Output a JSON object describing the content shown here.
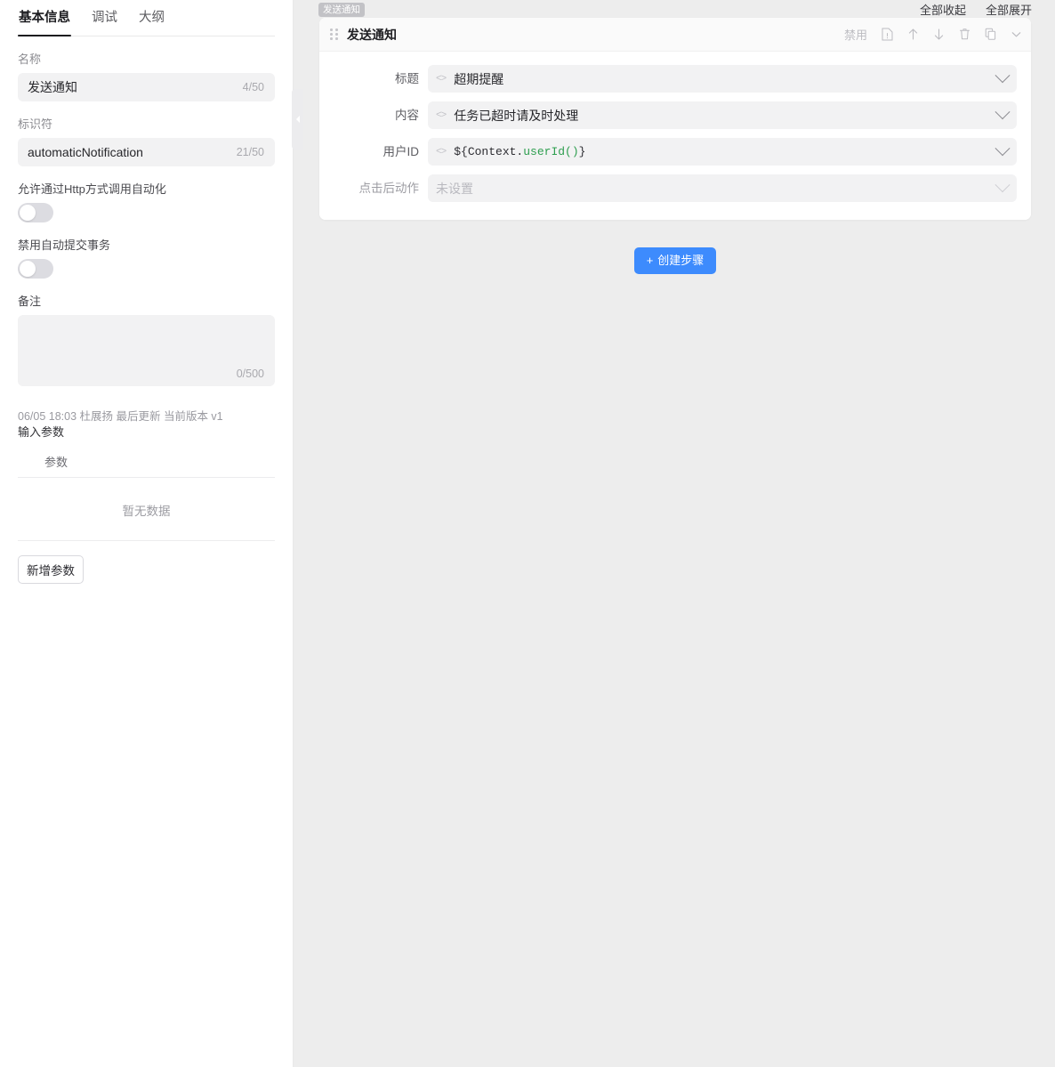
{
  "sidebar": {
    "tabs": [
      {
        "label": "基本信息",
        "active": true
      },
      {
        "label": "调试",
        "active": false
      },
      {
        "label": "大纲",
        "active": false
      }
    ],
    "name_field": {
      "label": "名称",
      "value": "发送通知",
      "counter": "4/50"
    },
    "identifier_field": {
      "label": "标识符",
      "value": "automaticNotification",
      "counter": "21/50"
    },
    "http_toggle": {
      "label": "允许通过Http方式调用自动化",
      "state": "off"
    },
    "transaction_toggle": {
      "label": "禁用自动提交事务",
      "state": "off"
    },
    "remark_field": {
      "label": "备注",
      "value": "",
      "counter": "0/500"
    },
    "meta": "06/05 18:03 杜展扬 最后更新 当前版本 v1",
    "input_params_title": "输入参数",
    "param_table": {
      "columns": [
        "参数"
      ],
      "empty_text": "暂无数据"
    },
    "add_param_button": "新增参数",
    "collapse_handle_icon": "chevron-left-icon"
  },
  "main": {
    "tooltip_badge": "发送通知",
    "top_actions": [
      {
        "label": "全部收起",
        "name": "collapse-all-button"
      },
      {
        "label": "全部展开",
        "name": "expand-all-button"
      }
    ],
    "step_card": {
      "title": "发送通知",
      "drag_handle_icon": "drag-dots-icon",
      "actions": {
        "disable_label": "禁用",
        "icons": [
          {
            "name": "document-icon"
          },
          {
            "name": "arrow-up-icon"
          },
          {
            "name": "arrow-down-icon"
          },
          {
            "name": "trash-icon"
          },
          {
            "name": "copy-icon"
          },
          {
            "name": "chevron-down-icon"
          }
        ]
      },
      "rows": [
        {
          "label": "标题",
          "type": "text",
          "code_icon": "<>",
          "value": "超期提醒",
          "disabled": false
        },
        {
          "label": "内容",
          "type": "text",
          "code_icon": "<>",
          "value": "任务已超时请及时处理",
          "disabled": false
        },
        {
          "label": "用户ID",
          "type": "expression",
          "code_icon": "<>",
          "value": "${Context.userId()}",
          "expr_parts": {
            "prefix": "${",
            "object": "Context",
            "dot": ".",
            "method": "userId()",
            "suffix": "}"
          },
          "disabled": false
        },
        {
          "label": "点击后动作",
          "type": "select",
          "placeholder": "未设置",
          "value": "",
          "disabled": true
        }
      ]
    },
    "create_step_button": {
      "label": "创建步骤",
      "plus": "+"
    }
  },
  "colors": {
    "accent": "#3d8bfd",
    "panel_bg": "#ededed",
    "field_bg": "#f2f2f3",
    "code_green": "#2e9e4f",
    "code_brace": "#3b6fd4"
  }
}
